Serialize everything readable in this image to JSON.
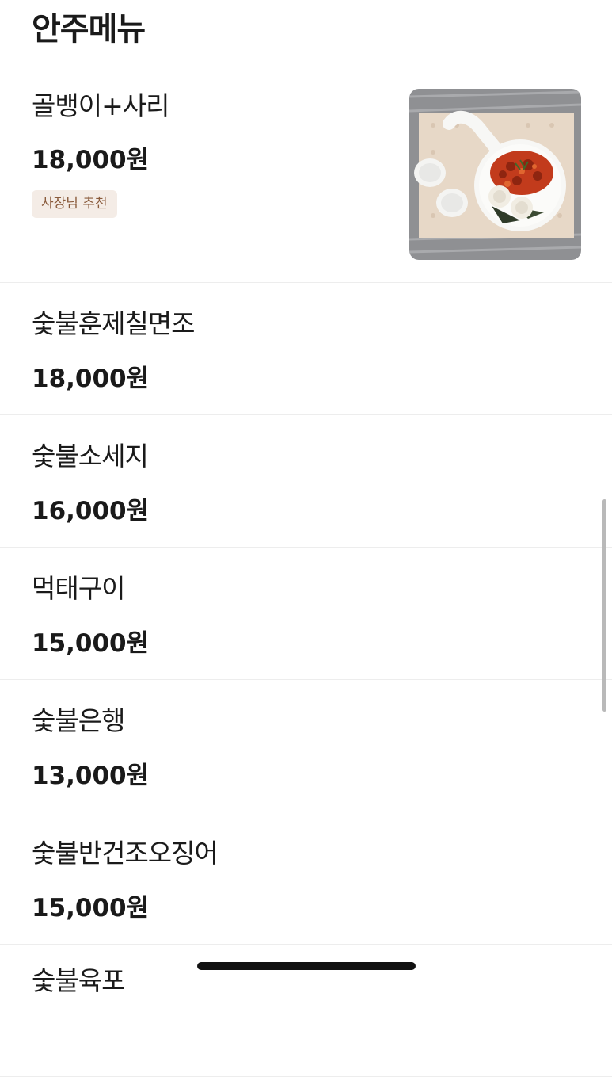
{
  "section": {
    "title": "안주메뉴"
  },
  "items": [
    {
      "name": "골뱅이+사리",
      "price": "18,000원",
      "badge": "사장님 추천"
    },
    {
      "name": "숯불훈제칠면조",
      "price": "18,000원"
    },
    {
      "name": "숯불소세지",
      "price": "16,000원"
    },
    {
      "name": "먹태구이",
      "price": "15,000원"
    },
    {
      "name": "숯불은행",
      "price": "13,000원"
    },
    {
      "name": "숯불반건조오징어",
      "price": "15,000원"
    },
    {
      "name": "숯불육포"
    }
  ],
  "colors": {
    "badge_bg": "#f4ece6",
    "badge_text": "#8a5b3c",
    "divider": "#ededed"
  }
}
